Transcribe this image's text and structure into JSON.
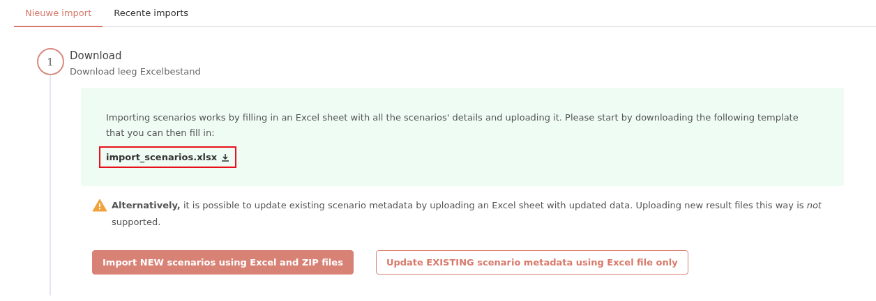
{
  "tabs": [
    {
      "label": "Nieuwe import",
      "selected": true
    },
    {
      "label": "Recente imports",
      "selected": false
    }
  ],
  "step": {
    "number": "1",
    "title": "Download",
    "subtitle": "Download leeg Excelbestand",
    "info": {
      "text": "Importing scenarios works by filling in an Excel sheet with all the scenarios' details and uploading it. Please start by downloading the following template that you can then fill in:",
      "link": {
        "label": "import_scenarios.xlsx",
        "highlighted": true
      }
    },
    "warning": "**Alternatively,** it is possible to update existing scenario metadata by uploading an Excel sheet with updated data. Uploading new result files this way is *not* supported.",
    "buttons": [
      {
        "label": "Import NEW scenarios using Excel and ZIP files",
        "kind": "primary"
      },
      {
        "label": "Update EXISTING scenario metadata using Excel file only",
        "kind": "outline"
      }
    ]
  }
}
